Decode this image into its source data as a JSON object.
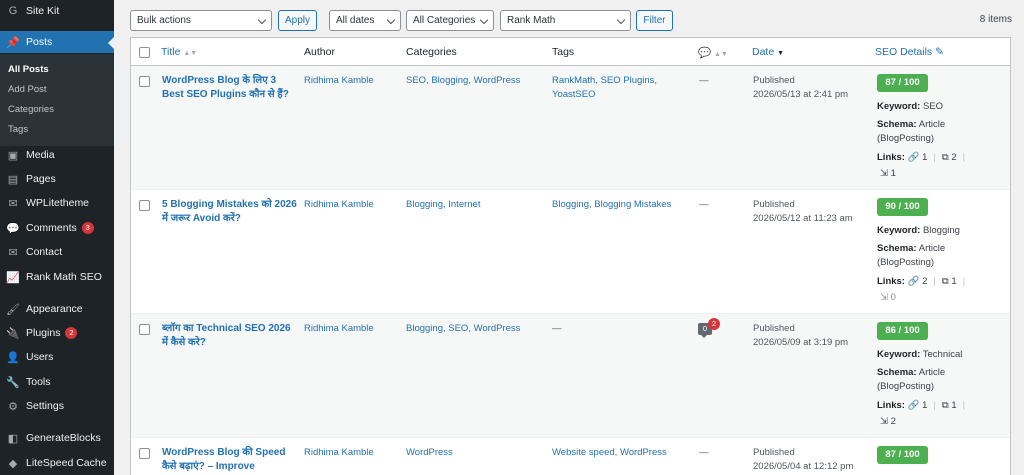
{
  "sidebar": {
    "site_kit": "Site Kit",
    "posts": "Posts",
    "submenu": [
      "All Posts",
      "Add Post",
      "Categories",
      "Tags"
    ],
    "media": "Media",
    "pages": "Pages",
    "wplitetheme": "WPLitetheme",
    "comments": "Comments",
    "comments_badge": "3",
    "contact": "Contact",
    "rankmath": "Rank Math SEO",
    "appearance": "Appearance",
    "plugins": "Plugins",
    "plugins_badge": "2",
    "users": "Users",
    "tools": "Tools",
    "settings": "Settings",
    "generateblocks": "GenerateBlocks",
    "litespeed": "LiteSpeed Cache"
  },
  "filters": {
    "bulk_actions": "Bulk actions",
    "apply": "Apply",
    "dates": "All dates",
    "categories": "All Categories",
    "rankmath": "Rank Math",
    "filter": "Filter",
    "items_count": "8 items"
  },
  "columns": {
    "title": "Title",
    "author": "Author",
    "categories": "Categories",
    "tags": "Tags",
    "date": "Date",
    "seo": "SEO Details"
  },
  "labels": {
    "keyword": "Keyword:",
    "schema": "Schema:",
    "links": "Links:"
  },
  "rows": [
    {
      "title": "WordPress Blog के लिए 3 Best SEO Plugins कौन से हैं?",
      "author": "Ridhima Kamble",
      "categories": "SEO, Blogging, WordPress",
      "tags": "RankMath, SEO Plugins, YoastSEO",
      "comments": "—",
      "status": "Published",
      "date": "2026/05/13 at 2:41 pm",
      "score": "87 / 100",
      "keyword": "SEO",
      "schema": "Article (BlogPosting)",
      "links_internal": "1",
      "links_external": "2",
      "links_incoming": "1"
    },
    {
      "title": "5 Blogging Mistakes को 2026 में जरूर Avoid करें?",
      "author": "Ridhima Kamble",
      "categories": "Blogging, Internet",
      "tags": "Blogging, Blogging Mistakes",
      "comments": "—",
      "status": "Published",
      "date": "2026/05/12 at 11:23 am",
      "score": "90 / 100",
      "keyword": "Blogging",
      "schema": "Article (BlogPosting)",
      "links_internal": "2",
      "links_external": "1",
      "links_incoming": "0"
    },
    {
      "title": "ब्लॉग का Technical SEO 2026 में कैसे करे?",
      "author": "Ridhima Kamble",
      "categories": "Blogging, SEO, WordPress",
      "tags": "—",
      "comments_approved": "0",
      "comments_pending": "2",
      "status": "Published",
      "date": "2026/05/09 at 3:19 pm",
      "score": "86 / 100",
      "keyword": "Technical",
      "schema": "Article (BlogPosting)",
      "links_internal": "1",
      "links_external": "1",
      "links_incoming": "2"
    },
    {
      "title": "WordPress Blog की Speed कैसे बढ़ाएं? – Improve",
      "author": "Ridhima Kamble",
      "categories": "WordPress",
      "tags": "Website speed, WordPress",
      "comments": "—",
      "status": "Published",
      "date": "2026/05/04 at 12:12 pm",
      "score": "87 / 100"
    }
  ],
  "colors": {
    "sidebar_bg": "#1d2327",
    "active_blue": "#2271b1",
    "score_green": "#4caf50"
  }
}
